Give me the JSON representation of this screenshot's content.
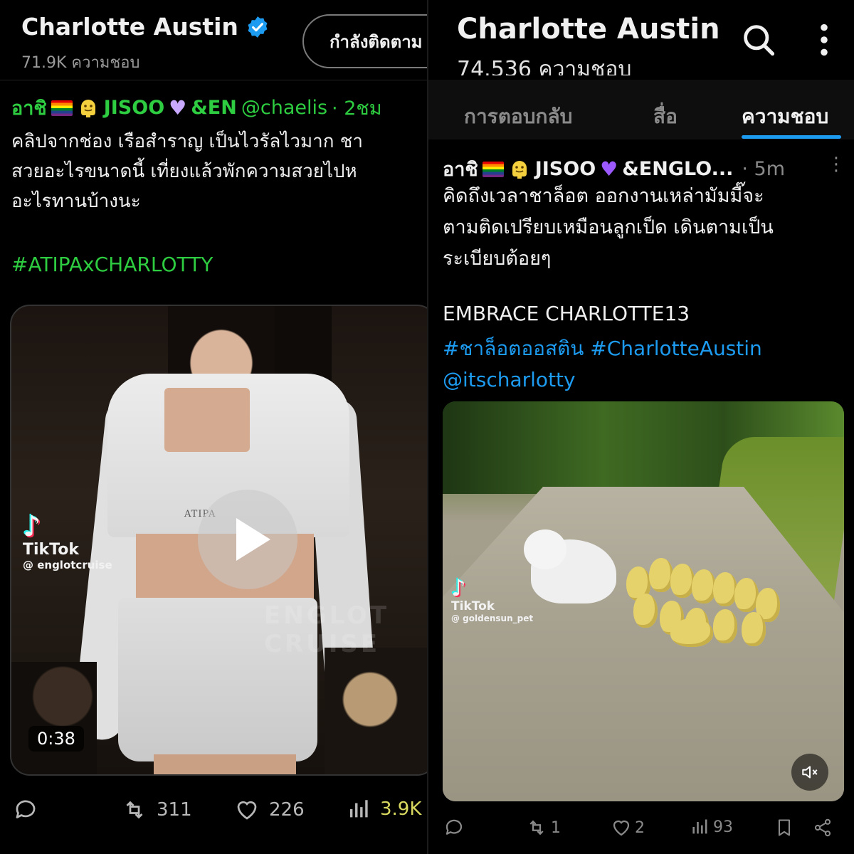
{
  "left": {
    "profile": {
      "name": "Charlotte Austin",
      "likes": "71.9K ความชอบ",
      "follow_label": "กำลังติดตาม"
    },
    "post": {
      "author_name": "อาชิ",
      "author_extra": "JISOO",
      "author_tail": "&EN",
      "handle": "@chaelis",
      "time": "· 2ชม",
      "text": "คลิปจากช่อง เรือสำราญ เป็นไวรัลไวมาก ชา\nสวยอะไรขนาดนี้ เที่ยงแล้วพักความสวยไปห\nอะไรทานบ้างนะ",
      "hashtag": "#ATIPAxCHARLOTTY",
      "video": {
        "shirt_brand": "ATIPA",
        "tiktok_word": "TikTok",
        "tiktok_user": "@ englotcruise",
        "watermark": "ENGLOT\nCRUISE",
        "duration": "0:38"
      },
      "actions": {
        "retweets": "311",
        "likes": "226",
        "views": "3.9K"
      }
    }
  },
  "right": {
    "header": {
      "name": "Charlotte Austin",
      "likes": "74.536 ความชอบ"
    },
    "tabs": [
      {
        "label": "การตอบกลับ",
        "active": false
      },
      {
        "label": "สื่อ",
        "active": false
      },
      {
        "label": "ความชอบ",
        "active": true
      }
    ],
    "post": {
      "author_name": "อาชิ",
      "author_extra": "JISOO",
      "author_tail": "&ENGLO...",
      "time": "· 5m",
      "text": "คิดถึงเวลาชาล็อต ออกงานเหล่ามัมมี๊จะ\nตามติดเปรียบเหมือนลูกเป็ด เดินตามเป็น\nระเบียบต้อยๆ",
      "embrace": "EMBRACE CHARLOTTE13",
      "tags_line1": "#ชาล็อตออสติน #CharlotteAustin",
      "tags_line2": "@itscharlotty",
      "video": {
        "tiktok_word": "TikTok",
        "tiktok_user": "@ goldensun_pet"
      },
      "actions": {
        "retweets": "1",
        "likes": "2",
        "views": "93"
      }
    }
  },
  "colors": {
    "accent_blue": "#1d9bf0",
    "hashtag_green": "#2ecc40",
    "verified_blue": "#1d9bf0"
  }
}
